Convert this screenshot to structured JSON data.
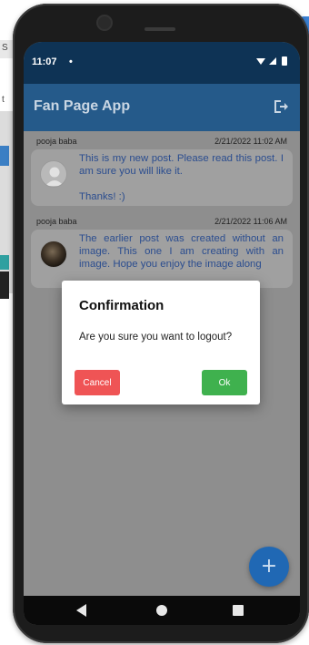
{
  "status_bar": {
    "time": "11:07",
    "dot": "•",
    "icons_text": "▾◢ ▮"
  },
  "app_bar": {
    "title": "Fan Page App",
    "logout_icon": "logout-icon"
  },
  "posts": [
    {
      "author": "pooja baba",
      "timestamp": "2/21/2022 11:02 AM",
      "text": "This is my new post. Please read this post. I am sure you will like it.\n\nThanks! :)",
      "avatar": "default-person"
    },
    {
      "author": "pooja baba",
      "timestamp": "2/21/2022 11:06 AM",
      "text": "The earlier post was created without an image. This one I am creating with an image. Hope you enjoy the image along",
      "avatar": "photo"
    }
  ],
  "dialog": {
    "title": "Confirmation",
    "message": "Are you sure you want to logout?",
    "cancel_label": "Cancel",
    "ok_label": "Ok"
  },
  "fab": {
    "label": "+"
  },
  "background": {
    "left_chars": [
      "S",
      "t"
    ]
  },
  "colors": {
    "status_bar": "#0e3355",
    "app_bar": "#255a8a",
    "cancel": "#ef5455",
    "ok": "#3fb14e",
    "fab": "#2068b4",
    "post_text": "#2b4d8f"
  }
}
